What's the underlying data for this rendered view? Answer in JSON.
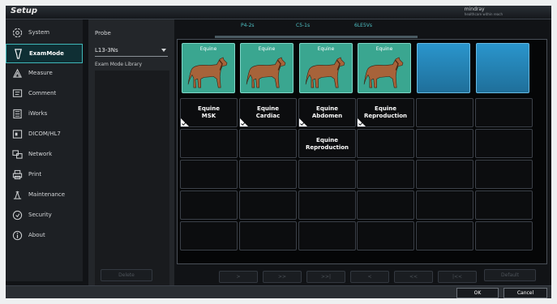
{
  "window": {
    "title": "Setup",
    "brand": "mindray",
    "brand_sub": "healthcare within reach"
  },
  "sidebar": {
    "items": [
      {
        "label": "System",
        "icon": "gear-icon",
        "active": false
      },
      {
        "label": "ExamMode",
        "icon": "probe-icon",
        "active": true
      },
      {
        "label": "Measure",
        "icon": "measure-icon",
        "active": false
      },
      {
        "label": "Comment",
        "icon": "comment-icon",
        "active": false
      },
      {
        "label": "iWorks",
        "icon": "iworks-icon",
        "active": false
      },
      {
        "label": "DICOM/HL7",
        "icon": "dicom-icon",
        "active": false
      },
      {
        "label": "Network",
        "icon": "network-icon",
        "active": false
      },
      {
        "label": "Print",
        "icon": "print-icon",
        "active": false
      },
      {
        "label": "Maintenance",
        "icon": "maintenance-icon",
        "active": false
      },
      {
        "label": "Security",
        "icon": "security-icon",
        "active": false
      },
      {
        "label": "About",
        "icon": "info-icon",
        "active": false
      }
    ]
  },
  "panel": {
    "probe_label": "Probe",
    "probe_value": "L13-3Ns",
    "library_label": "Exam Mode Library"
  },
  "tabs": [
    "P4-2s",
    "C5-1s",
    "6LE5Vs"
  ],
  "grid": {
    "thumbnails": [
      {
        "label": "Equine",
        "type": "horse"
      },
      {
        "label": "Equine",
        "type": "horse"
      },
      {
        "label": "Equine",
        "type": "horse"
      },
      {
        "label": "Equine",
        "type": "horse"
      },
      {
        "label": "",
        "type": "empty-blue"
      },
      {
        "label": "",
        "type": "empty-blue"
      }
    ],
    "modes": [
      [
        "Equine",
        "MSK"
      ],
      [
        "Equine",
        "Cardiac"
      ],
      [
        "Equine",
        "Abdomen"
      ],
      [
        "Equine",
        "Reproduction"
      ]
    ],
    "library_item": [
      "Equine",
      "Reproduction"
    ]
  },
  "buttons": {
    "delete": "Delete",
    "nav": [
      ">",
      ">>",
      ">>|",
      "<",
      "<<",
      "|<<"
    ],
    "default": "Default",
    "ok": "OK",
    "cancel": "Cancel"
  },
  "colors": {
    "accent": "#3fb7b9",
    "thumb_green": "#3aa690",
    "thumb_blue": "#2a95cc"
  }
}
